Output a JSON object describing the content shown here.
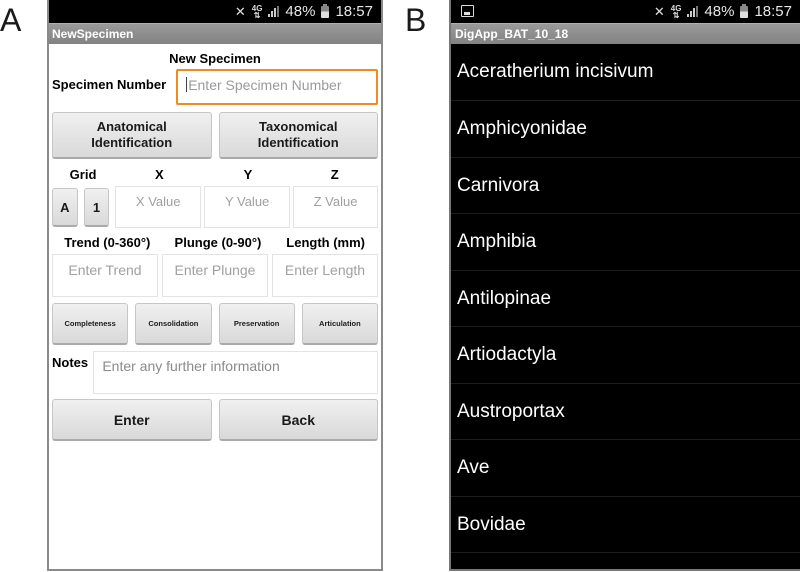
{
  "panel_labels": {
    "a": "A",
    "b": "B"
  },
  "status_bar": {
    "network": "4G",
    "battery": "48%",
    "time": "18:57"
  },
  "screen_a": {
    "title": "NewSpecimen",
    "heading": "New Specimen",
    "specimen_number": {
      "label": "Specimen Number",
      "placeholder": "Enter Specimen Number",
      "value": ""
    },
    "id_buttons": [
      {
        "line1": "Anatomical",
        "line2": "Identification"
      },
      {
        "line1": "Taxonomical",
        "line2": "Identification"
      }
    ],
    "grid": {
      "label": "Grid",
      "buttons": [
        "A",
        "1"
      ],
      "x_label": "X",
      "y_label": "Y",
      "z_label": "Z",
      "x_placeholder": "X Value",
      "y_placeholder": "Y Value",
      "z_placeholder": "Z Value"
    },
    "orientation": {
      "trend_label": "Trend (0-360°)",
      "plunge_label": "Plunge (0-90°)",
      "length_label": "Length (mm)",
      "trend_placeholder": "Enter Trend",
      "plunge_placeholder": "Enter Plunge",
      "length_placeholder": "Enter Length"
    },
    "attribute_buttons": [
      "Completeness",
      "Consolidation",
      "Preservation",
      "Articulation"
    ],
    "notes": {
      "label": "Notes",
      "placeholder": "Enter any further information"
    },
    "actions": {
      "enter": "Enter",
      "back": "Back"
    },
    "accent_color": "#f08c1e"
  },
  "screen_b": {
    "title": "DigApp_BAT_10_18",
    "taxa": [
      "Aceratherium incisivum",
      "Amphicyonidae",
      "Carnivora",
      "Amphibia",
      "Antilopinae",
      "Artiodactyla",
      "Austroportax",
      "Ave",
      "Bovidae"
    ]
  }
}
